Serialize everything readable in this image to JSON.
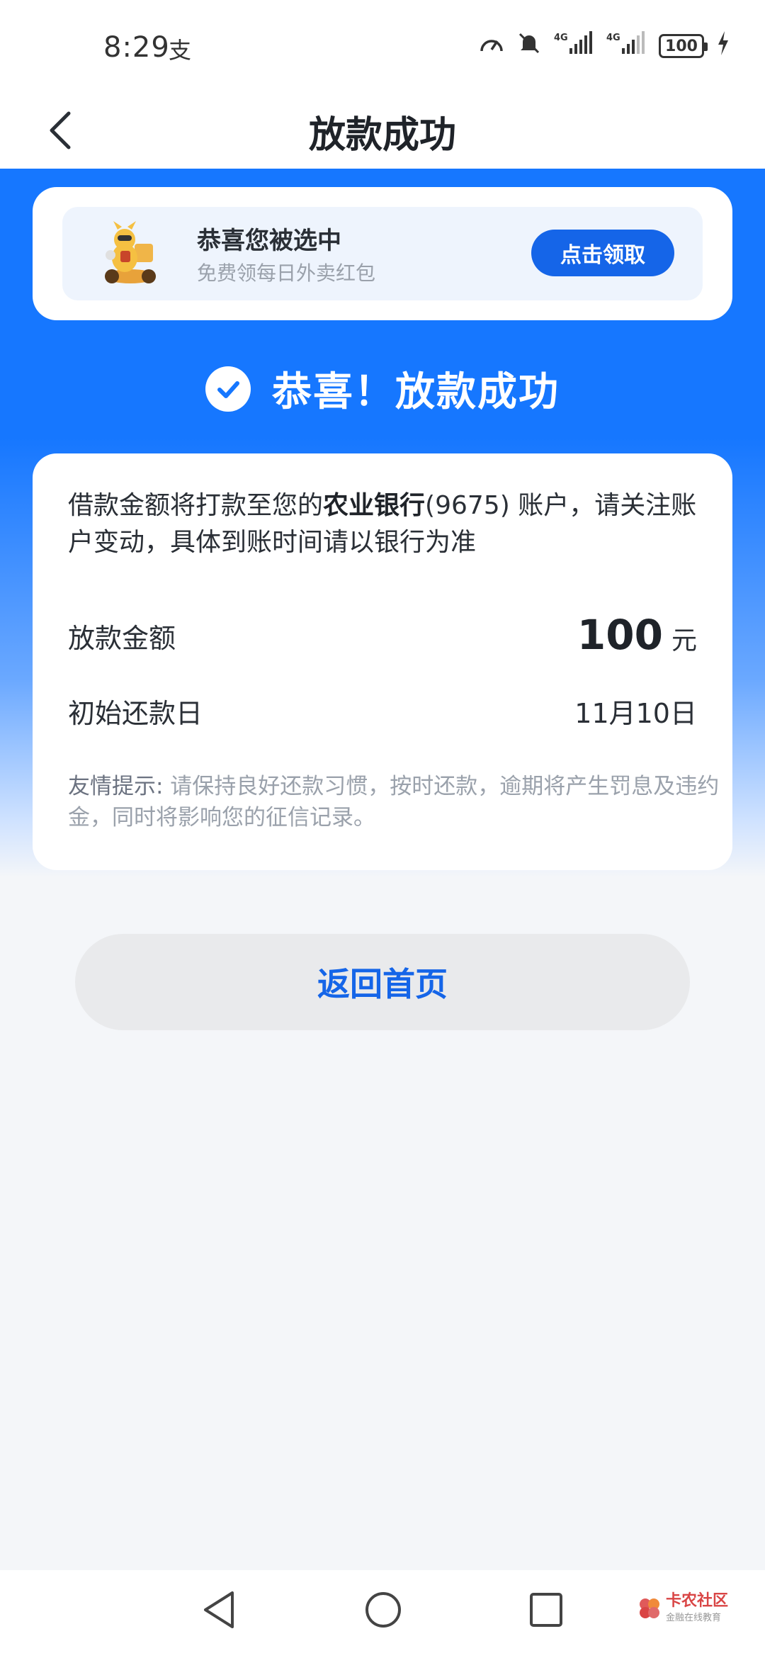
{
  "status_bar": {
    "time": "8:29",
    "extra_icon_glyph": "支",
    "network_1": "4G",
    "network_2": "4G",
    "battery": "100"
  },
  "header": {
    "title": "放款成功"
  },
  "promo": {
    "title": "恭喜您被选中",
    "subtitle": "免费领每日外卖红包",
    "button_label": "点击领取"
  },
  "success": {
    "heading": "恭喜！放款成功"
  },
  "info": {
    "message_part1": "借款金额将打款至您的",
    "bank_name": "农业银行",
    "account_suffix": "(9675)",
    "message_part2": " 账户，请关注账户变动，具体到账时间请以银行为准",
    "amount_label": "放款金额",
    "amount_value": "100",
    "amount_unit": "元",
    "repay_label": "初始还款日",
    "repay_date": "11月10日",
    "tip_label": "友情提示:",
    "tip_text": " 请保持良好还款习惯，按时还款，逾期将产生罚息及违约金，同时将影响您的征信记录。"
  },
  "actions": {
    "return_label": "返回首页"
  },
  "watermark": {
    "name": "卡农社区",
    "sub": "金融在线教育"
  },
  "colors": {
    "primary": "#1677ff",
    "button_blue": "#1565e8",
    "page_bg": "#f4f6f9"
  }
}
